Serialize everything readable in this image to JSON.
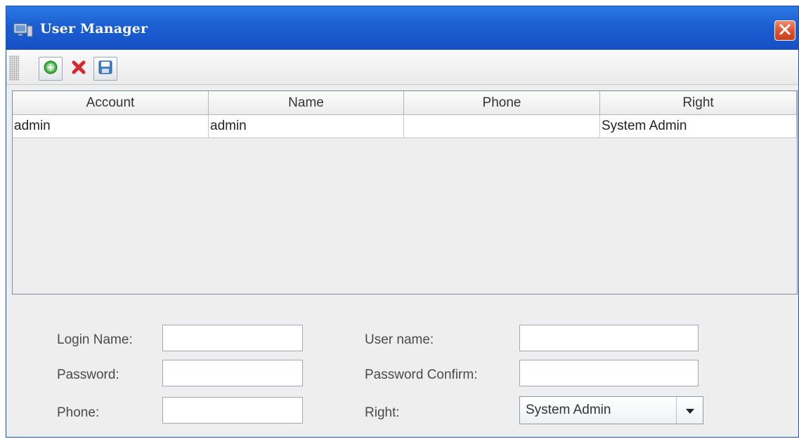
{
  "window": {
    "title": "User Manager"
  },
  "toolbar": {
    "buttons": [
      {
        "icon": "add-icon"
      },
      {
        "icon": "delete-icon"
      },
      {
        "icon": "save-icon"
      }
    ]
  },
  "table": {
    "columns": [
      "Account",
      "Name",
      "Phone",
      "Right"
    ],
    "rows": [
      {
        "account": "admin",
        "name": "admin",
        "phone": "",
        "right": "System Admin"
      }
    ]
  },
  "form": {
    "login_name_label": "Login Name:",
    "password_label": "Password:",
    "phone_label": "Phone:",
    "user_name_label": "User name:",
    "password_confirm_label": "Password Confirm:",
    "right_label": "Right:",
    "login_name_value": "",
    "password_value": "",
    "phone_value": "",
    "user_name_value": "",
    "password_confirm_value": "",
    "right_selected": "System Admin"
  },
  "colors": {
    "titlebar": "#1b5fd3",
    "close_button": "#e0532f",
    "add_icon": "#3fae3f",
    "delete_icon": "#d9262c",
    "save_icon": "#3f7fc8"
  }
}
